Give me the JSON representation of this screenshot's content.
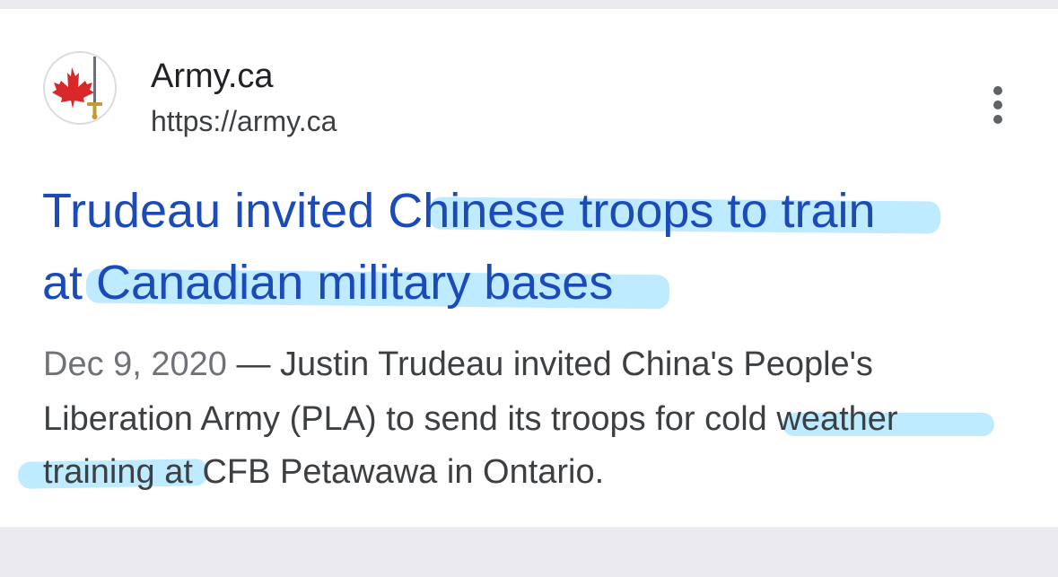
{
  "result": {
    "site_name": "Army.ca",
    "url": "https://army.ca",
    "title_line1": "Trudeau invited Chinese troops to train",
    "title_line2": "at Canadian military bases",
    "date": "Dec 9, 2020",
    "snippet_line1_rest": " — Justin Trudeau invited China's People's",
    "snippet_line2": "Liberation Army (PLA) to send its troops for cold weather",
    "snippet_line3": "training at CFB Petawawa in Ontario.",
    "favicon_icon": "maple-leaf-sword-icon",
    "more_icon": "more-vert-icon"
  },
  "colors": {
    "title_link": "#1a4bb8",
    "highlighter": "#6ed2ff",
    "background": "#ebebef",
    "card": "#ffffff",
    "maple_leaf": "#d8282a"
  }
}
